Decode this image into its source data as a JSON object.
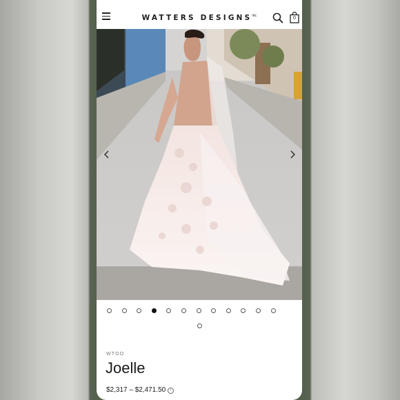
{
  "header": {
    "brand": "WATTERS DESIGNS",
    "brand_mark": "INC",
    "bag_count": "0",
    "icons": [
      "menu-icon",
      "search-icon",
      "shopping-bag-icon"
    ]
  },
  "gallery": {
    "total_images": 13,
    "active_index": 4,
    "controls": [
      "chevron-left-icon",
      "chevron-right-icon"
    ]
  },
  "product": {
    "sku": "WTOO",
    "name": "Joelle",
    "price": "$2,317 – $2,471.50",
    "price_info_glyph": "i"
  }
}
